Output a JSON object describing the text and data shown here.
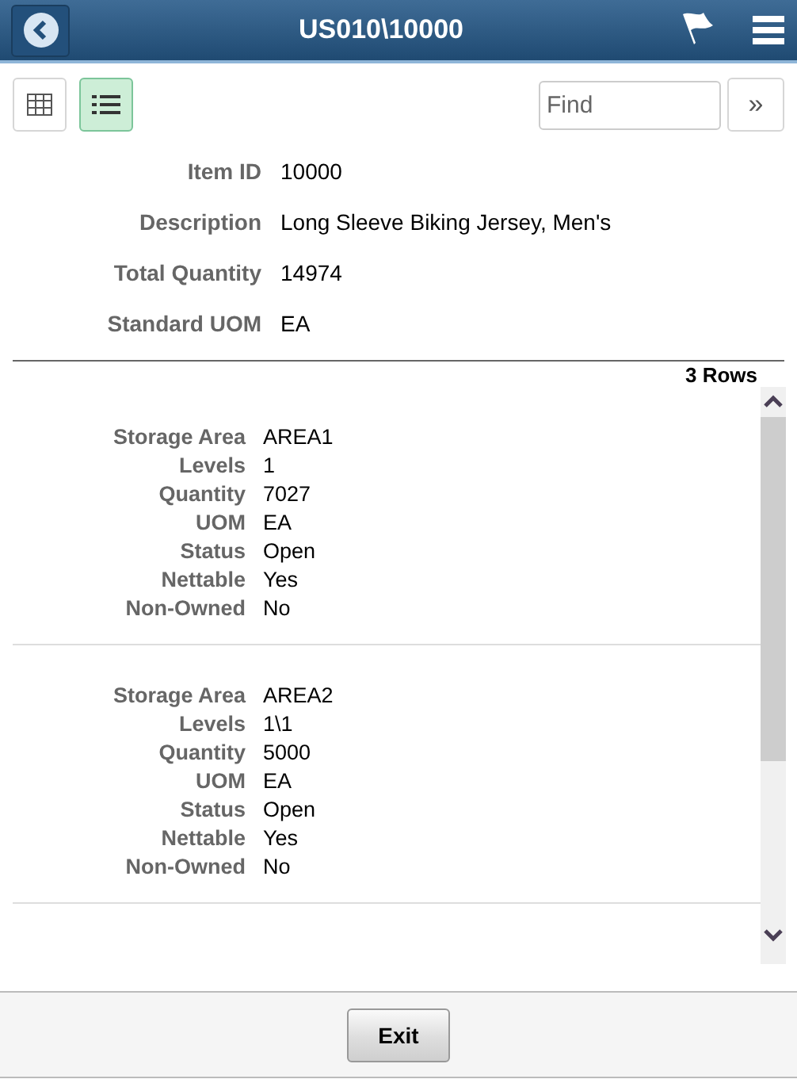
{
  "header": {
    "title": "US010\\10000"
  },
  "view_buttons": [
    {
      "kind": "grid",
      "selected": false
    },
    {
      "kind": "list",
      "selected": true
    }
  ],
  "search": {
    "placeholder": "Find"
  },
  "more_button": "»",
  "summary": [
    {
      "label": "Item ID",
      "value": "10000"
    },
    {
      "label": "Description",
      "value": "Long Sleeve Biking Jersey, Men's"
    },
    {
      "label": "Total Quantity",
      "value": "14974"
    },
    {
      "label": "Standard UOM",
      "value": "EA"
    }
  ],
  "row_count": "3 Rows",
  "records": [
    [
      {
        "label": "Storage Area",
        "value": "AREA1"
      },
      {
        "label": "Levels",
        "value": "1"
      },
      {
        "label": "Quantity",
        "value": "7027"
      },
      {
        "label": "UOM",
        "value": "EA"
      },
      {
        "label": "Status",
        "value": "Open"
      },
      {
        "label": "Nettable",
        "value": "Yes"
      },
      {
        "label": "Non-Owned",
        "value": "No"
      }
    ],
    [
      {
        "label": "Storage Area",
        "value": "AREA2"
      },
      {
        "label": "Levels",
        "value": "1\\1"
      },
      {
        "label": "Quantity",
        "value": "5000"
      },
      {
        "label": "UOM",
        "value": "EA"
      },
      {
        "label": "Status",
        "value": "Open"
      },
      {
        "label": "Nettable",
        "value": "Yes"
      },
      {
        "label": "Non-Owned",
        "value": "No"
      }
    ]
  ],
  "footer": {
    "exit_button": "Exit"
  }
}
